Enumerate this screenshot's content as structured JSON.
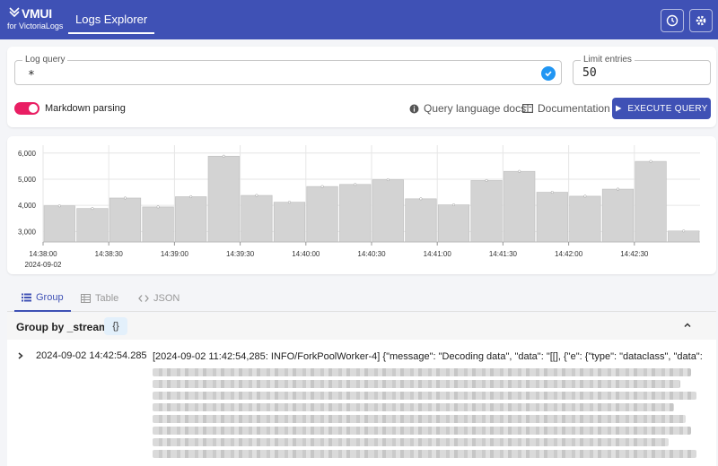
{
  "header": {
    "logo_main": "VMUI",
    "logo_sub": "for VictoriaLogs",
    "nav_tab": "Logs Explorer",
    "icons": [
      "clock-icon",
      "gear-icon"
    ]
  },
  "query": {
    "log_query_label": "Log query",
    "log_query_value": "*",
    "limit_label": "Limit entries",
    "limit_value": "50",
    "markdown_label": "Markdown parsing",
    "markdown_enabled": true,
    "docs_link": "Query language docs",
    "documentation_link": "Documentation",
    "execute_button": "EXECUTE QUERY"
  },
  "chart_data": {
    "type": "bar",
    "categories": [
      "14:38:00",
      "14:38:15",
      "14:38:30",
      "14:38:45",
      "14:39:00",
      "14:39:15",
      "14:39:30",
      "14:39:45",
      "14:40:00",
      "14:40:15",
      "14:40:30",
      "14:40:45",
      "14:41:00",
      "14:41:15",
      "14:41:30",
      "14:41:45",
      "14:42:00",
      "14:42:15",
      "14:42:30",
      "14:42:45"
    ],
    "values": [
      3980,
      3880,
      4280,
      3940,
      4330,
      5880,
      4380,
      4120,
      4720,
      4800,
      4980,
      4250,
      4020,
      4950,
      5300,
      4500,
      4350,
      4620,
      5680,
      3020
    ],
    "yticks": [
      "6,000",
      "5,000",
      "4,000",
      "3,000"
    ],
    "ytick_values": [
      6000,
      5000,
      4000,
      3000
    ],
    "xtick_labels": [
      "14:38:00",
      "14:38:30",
      "14:39:00",
      "14:39:30",
      "14:40:00",
      "14:40:30",
      "14:41:00",
      "14:41:30",
      "14:42:00",
      "14:42:30"
    ],
    "x_date": "2024-09-02",
    "ylim": [
      2600,
      6300
    ],
    "grid": true,
    "color": "#d3d3d3"
  },
  "tabs": [
    {
      "label": "Group",
      "icon": "list-icon",
      "active": true
    },
    {
      "label": "Table",
      "icon": "table-icon",
      "active": false
    },
    {
      "label": "JSON",
      "icon": "code-icon",
      "active": false
    }
  ],
  "group": {
    "label": "Group by _stream:",
    "chip": "{}",
    "row_time": "2024-09-02 14:42:54.285",
    "row_message": "[2024-09-02 11:42:54,285: INFO/ForkPoolWorker-4] {\"message\": \"Decoding data\", \"data\": \"[[], {\"e\": {\"type\": \"dataclass\", \"data\":"
  },
  "colors": {
    "primary": "#3f51b5",
    "toggle": "#e91e63",
    "check": "#2196f3"
  }
}
